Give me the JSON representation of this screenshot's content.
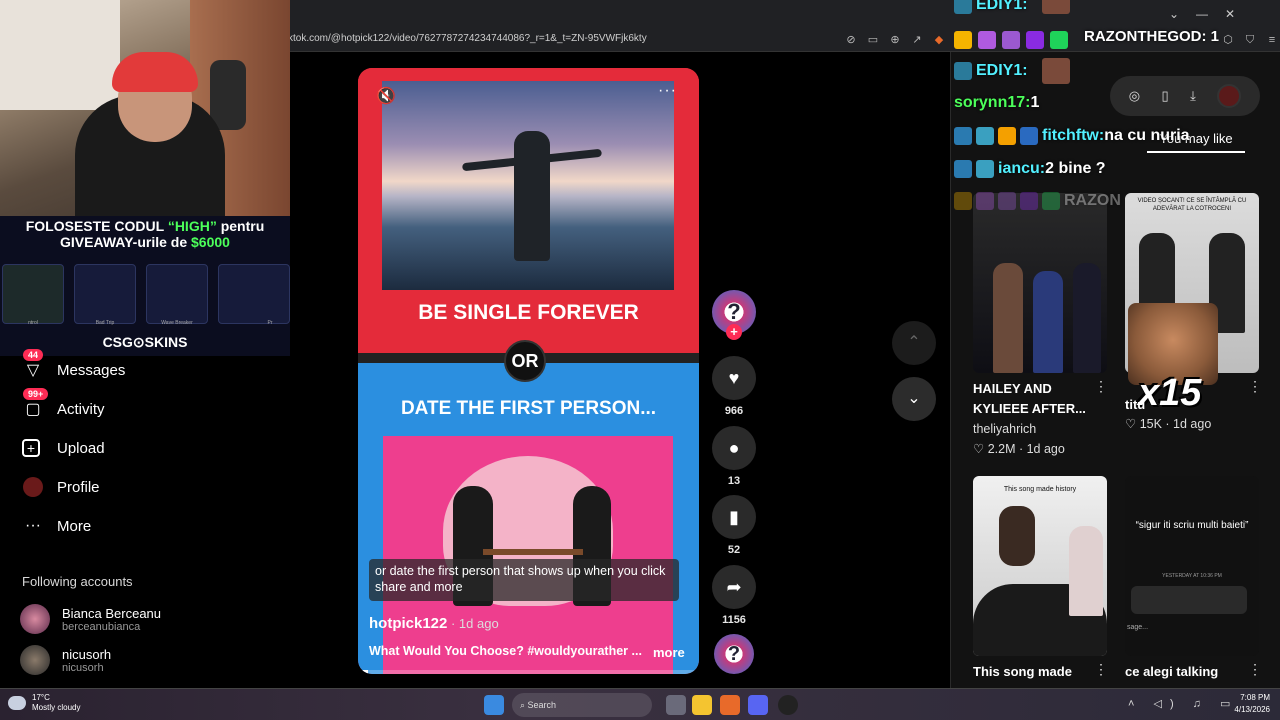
{
  "browser": {
    "url": "ktok.com/@hotpick122/video/7627787274234744086?_r=1&_t=ZN-95VWFjk6kty",
    "window_controls": [
      "⌄",
      "—",
      "▢",
      "✕"
    ]
  },
  "stream_overlay": {
    "promo_line1_a": "FOLOSESTE CODUL ",
    "promo_line1_code": "“HIGH”",
    "promo_line1_b": " pentru",
    "promo_line2_a": "GIVEAWAY-urile de ",
    "promo_line2_amount": "$6000",
    "skins": [
      "ntrol",
      "Bad Trip",
      "Wave Breaker",
      "Pr"
    ],
    "brand": "CSG⊙SKINS"
  },
  "sidebar": {
    "items": [
      {
        "label": "Messages",
        "badge": "44",
        "icon": "paper-plane-icon"
      },
      {
        "label": "Activity",
        "badge": "99+",
        "icon": "inbox-icon"
      },
      {
        "label": "Upload",
        "badge": "",
        "icon": "plus-square-icon"
      },
      {
        "label": "Profile",
        "badge": "",
        "icon": "avatar-icon"
      },
      {
        "label": "More",
        "badge": "",
        "icon": "ellipsis-icon"
      }
    ],
    "following_title": "Following accounts",
    "accounts": [
      {
        "name": "Bianca Berceanu",
        "handle": "berceanubianca"
      },
      {
        "name": "nicusorh",
        "handle": "nicusorh"
      }
    ]
  },
  "video": {
    "option1": "BE SINGLE FOREVER",
    "or_label": "OR",
    "option2": "DATE THE FIRST PERSON...",
    "caption": "or date the first person that shows up when you click share and more",
    "author": "hotpick122",
    "posted": " · 1d ago",
    "description": "What Would You Choose? #wouldyourather ...",
    "more_label": "more",
    "progress_fraction": 0.03,
    "mute_icon": "🔇",
    "menu_dots": "···"
  },
  "actions": {
    "creator_glyph": "?",
    "follow_glyph": "+",
    "likes": "966",
    "comments": "13",
    "saves": "52",
    "shares": "1156"
  },
  "nav": {
    "up": "⌃",
    "down": "⌄"
  },
  "chat": [
    {
      "user": "EDIY1:",
      "msg": "",
      "color": "u1"
    },
    {
      "user": "EDIY1:",
      "msg": "",
      "color": "u1"
    },
    {
      "user": "sorynn17:",
      "msg": " 1",
      "color": "u2"
    },
    {
      "user": "fitchftw:",
      "msg": " na cu nuria",
      "color": "u1"
    },
    {
      "user": "iancu:",
      "msg": " 2 bine ?",
      "color": "u1"
    }
  ],
  "chat_highlight_user": "RAZONTHEGOD",
  "chat_highlight_suffix": ": 1",
  "chat_faded_user": "RAZON",
  "right_panel": {
    "tab_label": "You may like",
    "videos": [
      {
        "title_line1": "HAILEY AND",
        "title_line2": "KYLIEEE AFTER...",
        "author": "theliyahrich",
        "likes": "2.2M",
        "ago": "1d ago"
      },
      {
        "title_line1": "",
        "title_line2": "titu",
        "author": "",
        "likes": "15K",
        "ago": "1d ago",
        "overlay": "VIDEO ȘOCANT! CE SE ÎNTÂMPLĂ CU ADEVĂRAT LA COTROCENI"
      },
      {
        "title_line1": "This song made",
        "author": "",
        "likes": "",
        "ago": "",
        "overlay": "This song made history"
      },
      {
        "title_line1": "ce alegi talking",
        "author": "",
        "likes": "",
        "ago": "",
        "overlay": "“sigur iti scriu multi baieti”"
      }
    ],
    "x15": "x15",
    "memo_time": "YESTERDAY AT 10:36 PM",
    "memo_sage": "sage..."
  },
  "taskbar": {
    "temp": "17°C",
    "weather": "Mostly cloudy",
    "search": "Search",
    "time": "7:08 PM",
    "date": "4/13/2026",
    "tray": "˄ ◁) ♫ ▭"
  }
}
